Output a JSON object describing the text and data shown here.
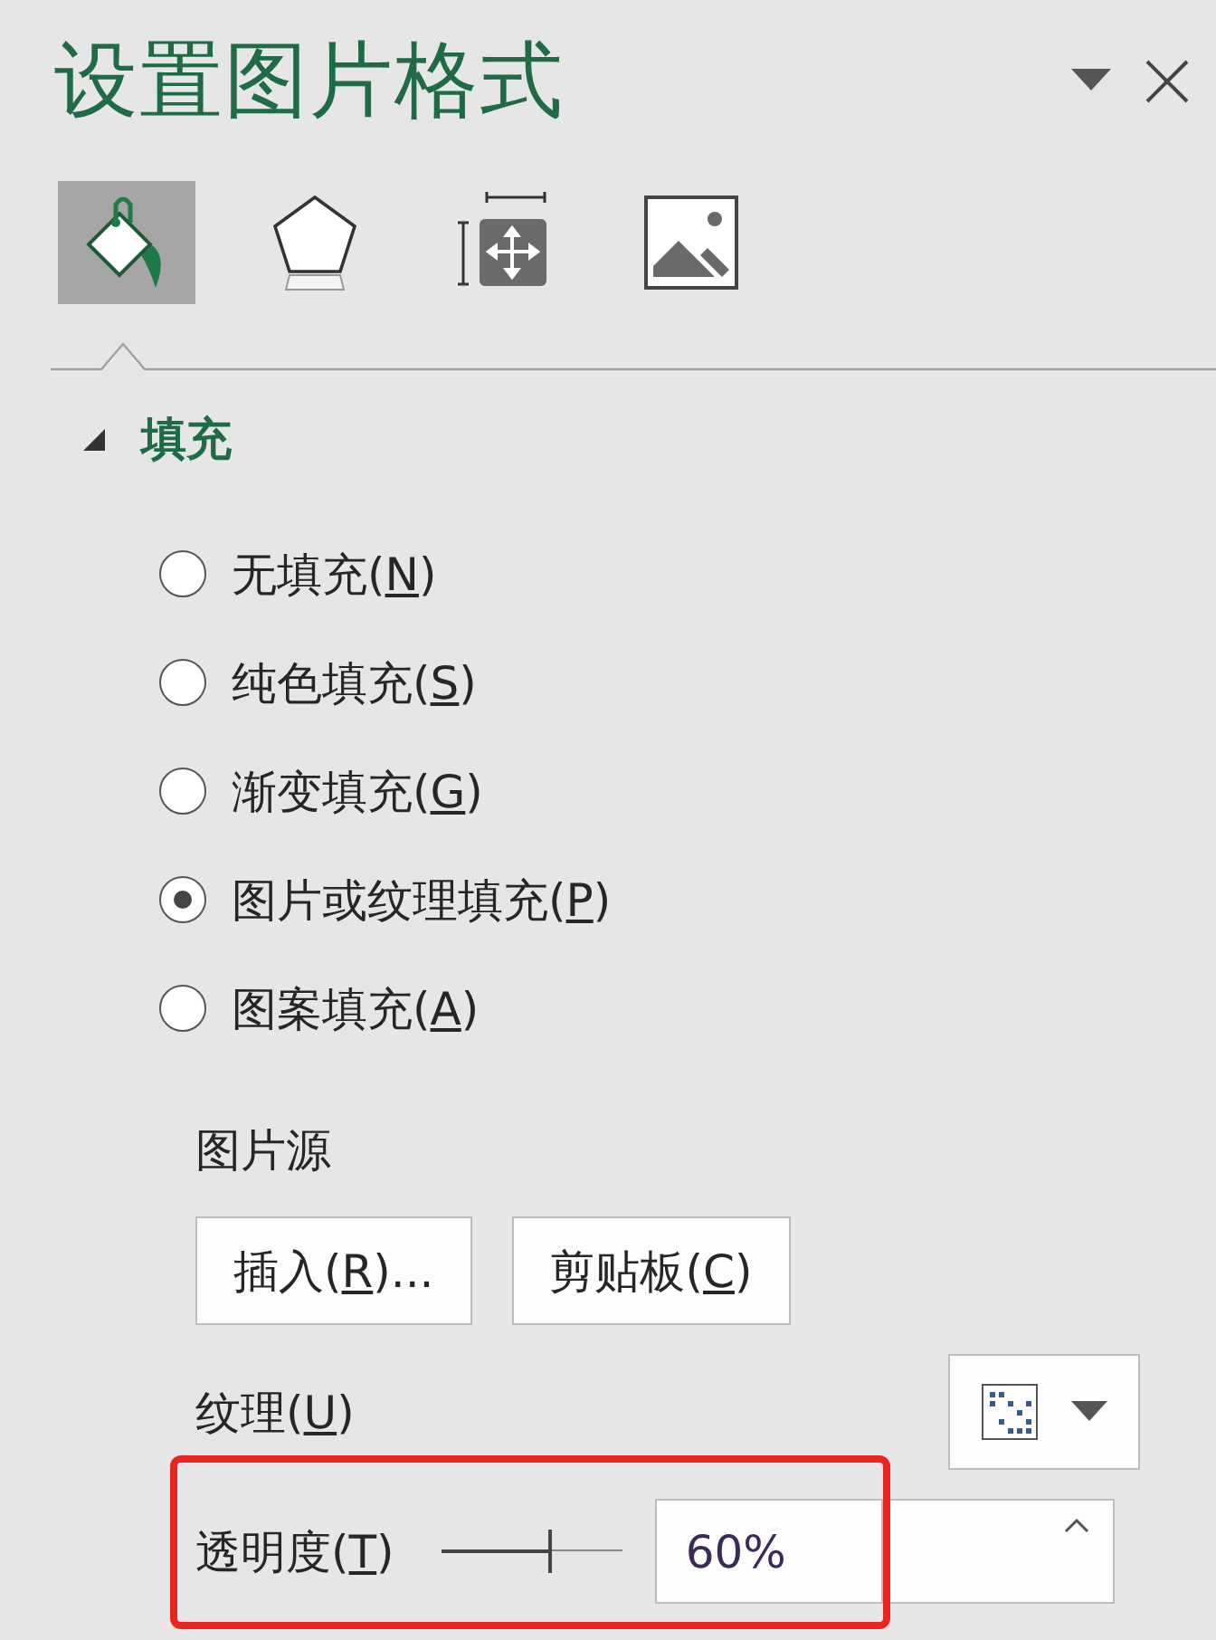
{
  "pane": {
    "title": "设置图片格式"
  },
  "tabs": [
    {
      "kind": "fill",
      "selected": true
    },
    {
      "kind": "shape",
      "selected": false
    },
    {
      "kind": "size",
      "selected": false
    },
    {
      "kind": "picture",
      "selected": false
    }
  ],
  "section": {
    "title": "填充",
    "expanded": true
  },
  "fill_options": [
    {
      "text": "无填充(",
      "key": "N",
      "tail": ")",
      "selected": false
    },
    {
      "text": "纯色填充(",
      "key": "S",
      "tail": ")",
      "selected": false
    },
    {
      "text": "渐变填充(",
      "key": "G",
      "tail": ")",
      "selected": false
    },
    {
      "text": "图片或纹理填充(",
      "key": "P",
      "tail": ")",
      "selected": true
    },
    {
      "text": "图案填充(",
      "key": "A",
      "tail": ")",
      "selected": false
    }
  ],
  "picture_source": {
    "label": "图片源",
    "buttons": [
      {
        "text": "插入(",
        "key": "R",
        "tail": ")..."
      },
      {
        "text": "剪贴板(",
        "key": "C",
        "tail": ")"
      }
    ]
  },
  "texture": {
    "text": "纹理(",
    "key": "U",
    "tail": ")"
  },
  "transparency": {
    "text": "透明度(",
    "key": "T",
    "tail": ")",
    "level": 0.6,
    "value": "60%",
    "highlighted": true
  }
}
